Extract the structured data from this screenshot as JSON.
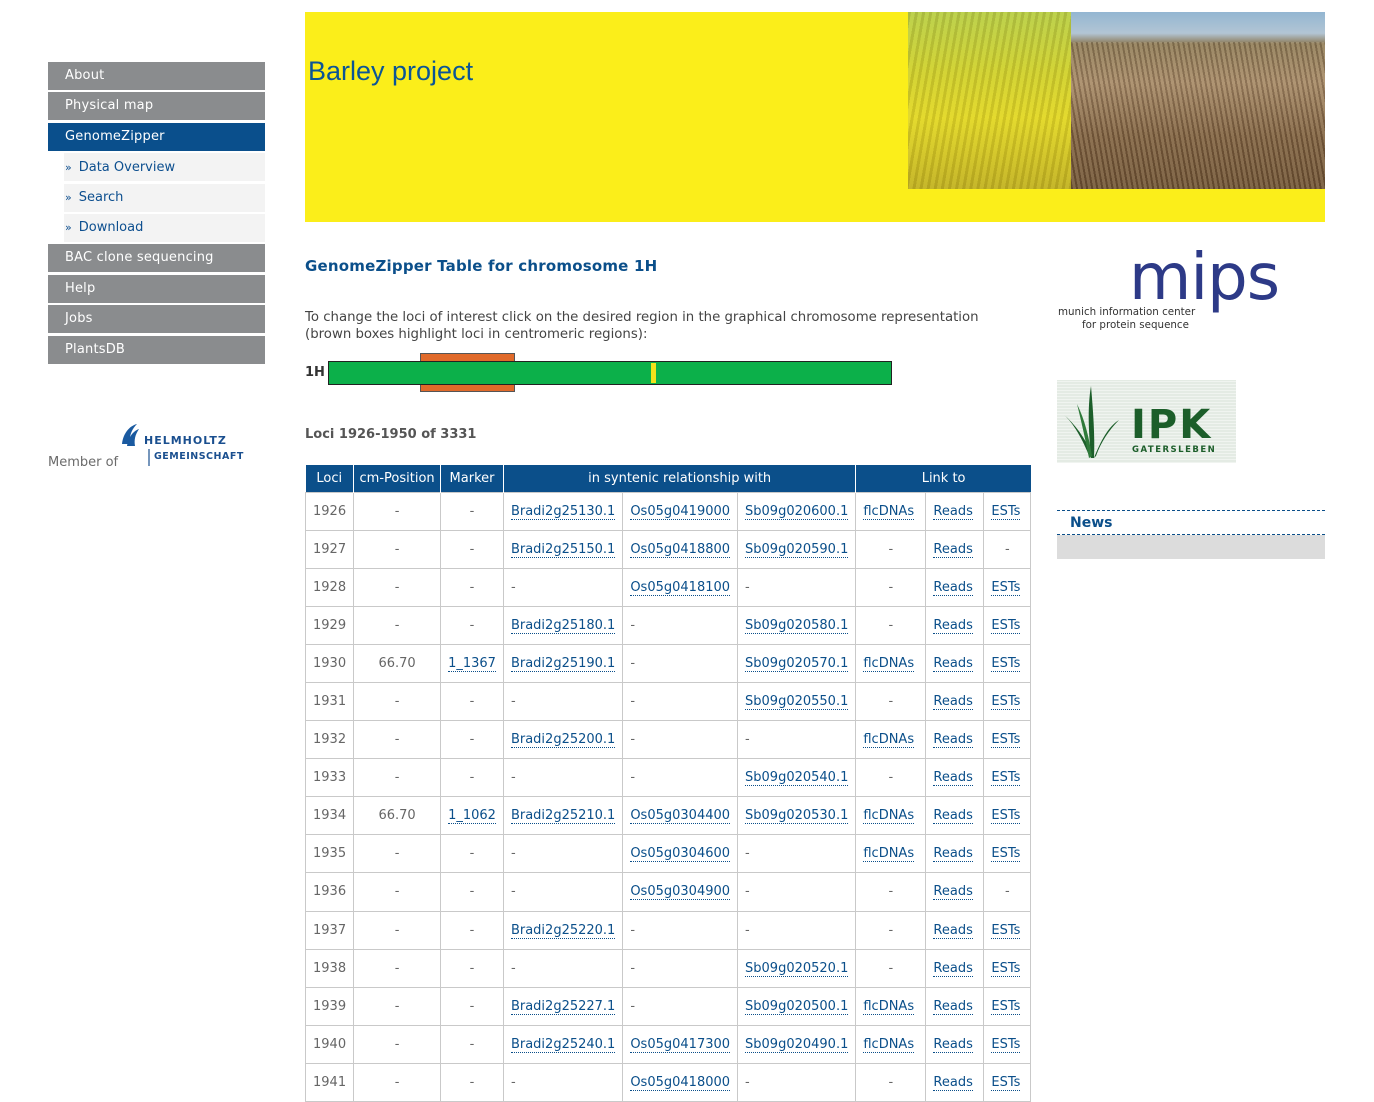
{
  "header": {
    "title": "Barley project"
  },
  "nav": {
    "items": [
      {
        "label": "About"
      },
      {
        "label": "Physical map"
      },
      {
        "label": "GenomeZipper"
      }
    ],
    "sub_items": [
      {
        "label": "Data Overview"
      },
      {
        "label": "Search"
      },
      {
        "label": "Download"
      }
    ],
    "items_after": [
      {
        "label": "BAC clone sequencing"
      },
      {
        "label": "Help"
      },
      {
        "label": "Jobs"
      },
      {
        "label": "PlantsDB"
      }
    ],
    "active": "GenomeZipper"
  },
  "helmholtz": {
    "member_of": "Member of",
    "line1": "HELMHOLTZ",
    "line2": "GEMEINSCHAFT"
  },
  "main": {
    "title": "GenomeZipper Table for chromosome 1H",
    "instructions": "To change the loci of interest click on the desired region in the graphical chromosome representation (brown boxes highlight loci in centromeric regions):",
    "chromosome_label": "1H",
    "loci_info": "Loci 1926-1950  of  3331"
  },
  "table": {
    "headers": [
      "Loci",
      "cm-Position",
      "Marker",
      "in syntenic relationship with",
      "Link to"
    ],
    "rows": [
      [
        "1926",
        "-",
        "-",
        "Bradi2g25130.1",
        "Os05g0419000",
        "Sb09g020600.1",
        "flcDNAs",
        "Reads",
        "ESTs"
      ],
      [
        "1927",
        "-",
        "-",
        "Bradi2g25150.1",
        "Os05g0418800",
        "Sb09g020590.1",
        "-",
        "Reads",
        "-"
      ],
      [
        "1928",
        "-",
        "-",
        "-",
        "Os05g0418100",
        "-",
        "-",
        "Reads",
        "ESTs"
      ],
      [
        "1929",
        "-",
        "-",
        "Bradi2g25180.1",
        "-",
        "Sb09g020580.1",
        "-",
        "Reads",
        "ESTs"
      ],
      [
        "1930",
        "66.70",
        "1_1367",
        "Bradi2g25190.1",
        "-",
        "Sb09g020570.1",
        "flcDNAs",
        "Reads",
        "ESTs"
      ],
      [
        "1931",
        "-",
        "-",
        "-",
        "-",
        "Sb09g020550.1",
        "-",
        "Reads",
        "ESTs"
      ],
      [
        "1932",
        "-",
        "-",
        "Bradi2g25200.1",
        "-",
        "-",
        "flcDNAs",
        "Reads",
        "ESTs"
      ],
      [
        "1933",
        "-",
        "-",
        "-",
        "-",
        "Sb09g020540.1",
        "-",
        "Reads",
        "ESTs"
      ],
      [
        "1934",
        "66.70",
        "1_1062",
        "Bradi2g25210.1",
        "Os05g0304400",
        "Sb09g020530.1",
        "flcDNAs",
        "Reads",
        "ESTs"
      ],
      [
        "1935",
        "-",
        "-",
        "-",
        "Os05g0304600",
        "-",
        "flcDNAs",
        "Reads",
        "ESTs"
      ],
      [
        "1936",
        "-",
        "-",
        "-",
        "Os05g0304900",
        "-",
        "-",
        "Reads",
        "-"
      ],
      [
        "1937",
        "-",
        "-",
        "Bradi2g25220.1",
        "-",
        "-",
        "-",
        "Reads",
        "ESTs"
      ],
      [
        "1938",
        "-",
        "-",
        "-",
        "-",
        "Sb09g020520.1",
        "-",
        "Reads",
        "ESTs"
      ],
      [
        "1939",
        "-",
        "-",
        "Bradi2g25227.1",
        "-",
        "Sb09g020500.1",
        "flcDNAs",
        "Reads",
        "ESTs"
      ],
      [
        "1940",
        "-",
        "-",
        "Bradi2g25240.1",
        "Os05g0417300",
        "Sb09g020490.1",
        "flcDNAs",
        "Reads",
        "ESTs"
      ],
      [
        "1941",
        "-",
        "-",
        "-",
        "Os05g0418000",
        "-",
        "-",
        "Reads",
        "ESTs"
      ]
    ]
  },
  "mips": {
    "word": "mips",
    "line1": "munich information center",
    "line2": "for protein sequence"
  },
  "ipk": {
    "word": "IPK",
    "sub": "GATERSLEBEN"
  },
  "news": {
    "title": "News"
  },
  "colors": {
    "brand_blue": "#0b4f8a",
    "header_yellow": "#fbee1a",
    "chromosome_green": "#0cb04a",
    "centromere_brown": "#e06a2a",
    "nav_gray": "#8a8c8e"
  }
}
